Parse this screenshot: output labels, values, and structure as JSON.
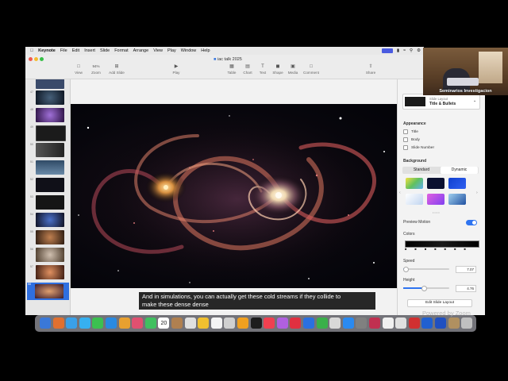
{
  "menubar": {
    "app": "Keynote",
    "items": [
      "File",
      "Edit",
      "Insert",
      "Slide",
      "Format",
      "Arrange",
      "View",
      "Play",
      "Window",
      "Help"
    ],
    "clock": "Fri 11:28"
  },
  "document": {
    "title": "iac talk 2025"
  },
  "toolbar": {
    "view": "View",
    "zoom": "Zoom",
    "zoom_value": "94%",
    "add_slide": "Add Slide",
    "play": "Play",
    "table": "Table",
    "chart": "Chart",
    "text": "Text",
    "shape": "Shape",
    "media": "Media",
    "comment": "Comment",
    "share": "Share"
  },
  "navigator": {
    "slides": [
      {
        "num": "",
        "color": "#3a4a6a"
      },
      {
        "num": "47",
        "color": "#1c2a3c"
      },
      {
        "num": "48",
        "color": "#5a3a8a"
      },
      {
        "num": "49",
        "color": "#1b1b1b"
      },
      {
        "num": "50",
        "color": "#333333"
      },
      {
        "num": "51",
        "color": "#2f4a66"
      },
      {
        "num": "52",
        "color": "#101018"
      },
      {
        "num": "53",
        "color": "#151515"
      },
      {
        "num": "54",
        "color": "#0f1020"
      },
      {
        "num": "55",
        "color": "#4a3a2a"
      },
      {
        "num": "56",
        "color": "#6a5a4a"
      },
      {
        "num": "57",
        "color": "#5a2a1a"
      },
      {
        "num": "58",
        "color": "#3a1a2a"
      }
    ]
  },
  "inspector": {
    "layout_label": "Slide Layout",
    "layout_value": "Title & Bullets",
    "appearance": "Appearance",
    "options": [
      "Title",
      "Body",
      "Slide Number"
    ],
    "background": "Background",
    "tab_standard": "Standard",
    "tab_dynamic": "Dynamic",
    "preview_motion": "Preview Motion",
    "colors": "Colors",
    "speed_label": "Speed",
    "speed_value": "7.07",
    "height_label": "Height",
    "height_value": "4.76",
    "edit_layout": "Edit Slide Layout",
    "speed_level": 0.05,
    "height_level": 0.45,
    "swatch_colors": [
      "#9fd06a",
      "#0a1030",
      "#1a3fc0",
      "#d8e4f4",
      "#c060e0",
      "#5aa0d0"
    ]
  },
  "caption": {
    "line1": "And in simulations, you can actually get these cold streams if they collide to",
    "line2": "make these dense dense"
  },
  "webcam": {
    "name": "Seminarios Investigacion"
  },
  "footer": {
    "powered": "Powered by Zoom"
  },
  "dock": {
    "icons": [
      "#3a78d8",
      "#e07030",
      "#3aa0e8",
      "#36b0f0",
      "#3cc050",
      "#2a8ae0",
      "#e8a030",
      "#e05070",
      "#40c060",
      "#c09060",
      "#b08050",
      "#e0e0e0",
      "#f0c030",
      "#f4f4f4",
      "#d0d0d0",
      "#f0a020",
      "#1d1d1d",
      "#f04050",
      "#b060e0",
      "#e03040",
      "#2a70e0",
      "#3ab04a",
      "#d8d8d8",
      "#2a8af0",
      "#808080",
      "#c03050",
      "#f0f0f0",
      "#e0e0e0",
      "#d03030",
      "#2060d0",
      "#2050c0",
      "#b09060",
      "#c0c0c0"
    ],
    "date": "20"
  }
}
